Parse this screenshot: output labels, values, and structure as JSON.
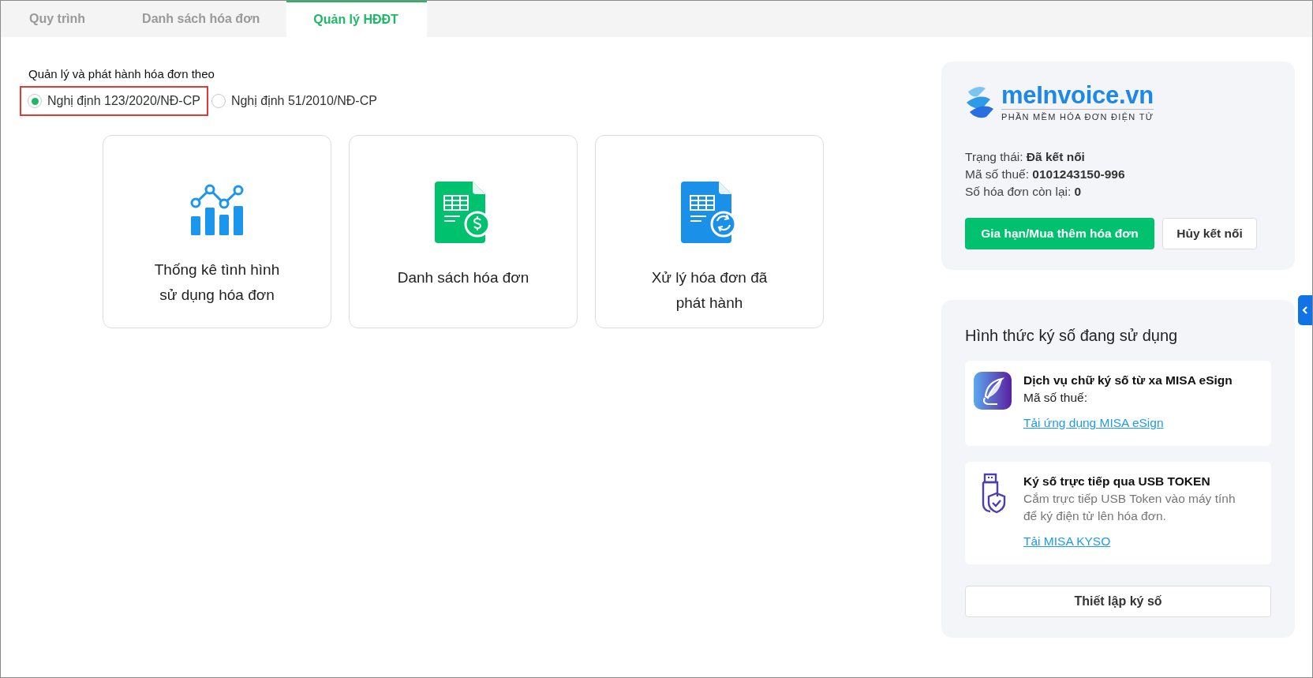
{
  "tabs": [
    {
      "label": "Quy trình",
      "selected": false
    },
    {
      "label": "Danh sách hóa đơn",
      "selected": false
    },
    {
      "label": "Quản lý HĐĐT",
      "selected": true
    }
  ],
  "regulation": {
    "label": "Quản lý và phát hành hóa đơn theo",
    "options": [
      {
        "label": "Nghị định 123/2020/NĐ-CP",
        "selected": true,
        "highlighted": true
      },
      {
        "label": "Nghị định 51/2010/NĐ-CP",
        "selected": false,
        "highlighted": false
      }
    ]
  },
  "cards": [
    {
      "kind": "chart",
      "lines": [
        "Thống kê tình hình",
        "sử dụng hóa đơn"
      ]
    },
    {
      "kind": "invoice-list",
      "lines": [
        "Danh sách hóa đơn"
      ]
    },
    {
      "kind": "invoice-process",
      "lines": [
        "Xử lý hóa đơn đã",
        "phát hành"
      ]
    }
  ],
  "account": {
    "logo": {
      "name": "meInvoice.vn",
      "tagline": "PHẦN MỀM HÓA ĐƠN ĐIỆN TỬ"
    },
    "info": [
      {
        "label": "Trạng thái:",
        "value": "Đã kết nối"
      },
      {
        "label": "Mã số thuế:",
        "value": "0101243150-996"
      },
      {
        "label": "Số hóa đơn còn lại:",
        "value": "0"
      }
    ],
    "buttons": [
      {
        "label": "Gia hạn/Mua thêm hóa đơn",
        "kind": "primary"
      },
      {
        "label": "Hủy kết nối",
        "kind": "secondary"
      }
    ]
  },
  "signing": {
    "title": "Hình thức ký số đang sử dụng",
    "methods": [
      {
        "kind": "esign",
        "title": "Dịch vụ chữ ký số từ xa MISA eSign",
        "subtitle": "Mã số thuế:",
        "link": "Tải ứng dụng MISA eSign"
      },
      {
        "kind": "usb",
        "title": "Ký số trực tiếp qua USB TOKEN",
        "description": "Cắm trực tiếp USB Token vào máy tính để ký điện tử lên hóa đơn.",
        "link": "Tải MISA KYSO"
      }
    ],
    "button": "Thiết lập ký số"
  }
}
